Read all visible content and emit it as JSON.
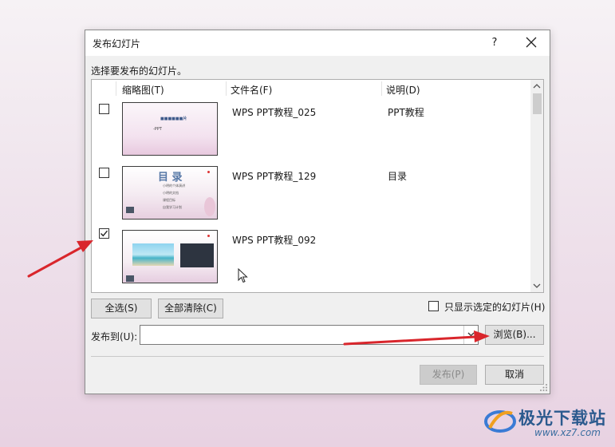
{
  "dialog": {
    "title": "发布幻灯片",
    "help": "?",
    "instruction": "选择要发布的幻灯片。"
  },
  "columns": {
    "thumbnail": "缩略图(T)",
    "filename": "文件名(F)",
    "description": "说明(D)"
  },
  "slides": [
    {
      "checked": false,
      "filename": "WPS PPT教程_025",
      "description": "PPT教程",
      "thumb": {
        "title": "■■■■■■片",
        "sub": "-PPT"
      }
    },
    {
      "checked": false,
      "filename": "WPS PPT教程_129",
      "description": "目录",
      "thumb": {
        "title": "目 录",
        "items": [
          "小明的个体演讲",
          "小明的文档",
          "课程目标",
          "自我学习计划"
        ]
      }
    },
    {
      "checked": true,
      "filename": "WPS PPT教程_092",
      "description": "",
      "thumb": {}
    }
  ],
  "buttons": {
    "select_all": "全选(S)",
    "clear_all": "全部清除(C)",
    "browse": "浏览(B)...",
    "publish": "发布(P)",
    "cancel": "取消"
  },
  "only_selected": {
    "label": "只显示选定的幻灯片(H)",
    "checked": false
  },
  "publish_to": {
    "label": "发布到(U):",
    "value": ""
  },
  "watermark": {
    "name": "极光下载站",
    "url": "www.xz7.com"
  },
  "colors": {
    "arrow": "#d9262c",
    "brand": "#2b5a8e"
  }
}
